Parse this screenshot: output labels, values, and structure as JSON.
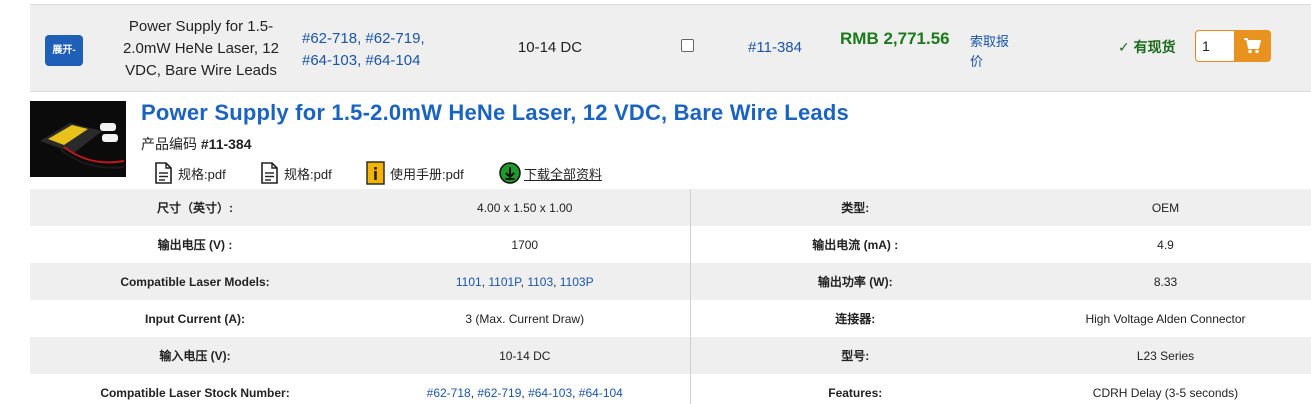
{
  "row": {
    "expand_label": "展开-",
    "product_name": "Power Supply for 1.5-2.0mW HeNe Laser, 12 VDC, Bare Wire Leads",
    "compatible_links": [
      "#62-718",
      "#62-719",
      "#64-103",
      "#64-104"
    ],
    "voltage": "10-14 DC",
    "stock_number": "#11-384",
    "price": "RMB 2,771.56",
    "quote_line1": "索取报",
    "quote_line2": "价",
    "stock_status": "有现货",
    "quantity": "1"
  },
  "detail": {
    "title": "Power Supply for 1.5-2.0mW HeNe Laser, 12 VDC, Bare Wire Leads",
    "code_label": "产品编码",
    "code_value": "#11-384",
    "docs": [
      {
        "label": "规格:pdf",
        "icon": "document-icon"
      },
      {
        "label": "规格:pdf",
        "icon": "document-icon"
      },
      {
        "label": "使用手册:pdf",
        "icon": "manual-icon"
      },
      {
        "label": "下载全部资料",
        "icon": "download-icon"
      }
    ]
  },
  "specs": [
    {
      "l1": "尺寸（英寸）:",
      "v1": "4.00 x 1.50 x 1.00",
      "l2": "类型:",
      "v2": "OEM"
    },
    {
      "l1": "输出电压 (V) :",
      "v1": "1700",
      "l2": "输出电流 (mA) :",
      "v2": "4.9"
    },
    {
      "l1": "Compatible Laser Models:",
      "v1_links": [
        "1101",
        "1101P",
        "1103",
        "1103P"
      ],
      "l2": "输出功率 (W):",
      "v2": "8.33"
    },
    {
      "l1": "Input Current (A):",
      "v1": "3 (Max. Current Draw)",
      "l2": "连接器:",
      "v2": "High Voltage Alden Connector"
    },
    {
      "l1": "输入电压 (V):",
      "v1": "10-14 DC",
      "l2": "型号:",
      "v2": "L23 Series"
    },
    {
      "l1": "Compatible Laser Stock Number:",
      "v1_links": [
        "#62-718",
        "#62-719",
        "#64-103",
        "#64-104"
      ],
      "l2": "Features:",
      "v2": "CDRH Delay (3-5 seconds)"
    }
  ],
  "colors": {
    "accent_blue": "#1a64c0",
    "price_green": "#1b7a1b",
    "cart_orange": "#e8921f",
    "row_gray": "#efefef"
  }
}
